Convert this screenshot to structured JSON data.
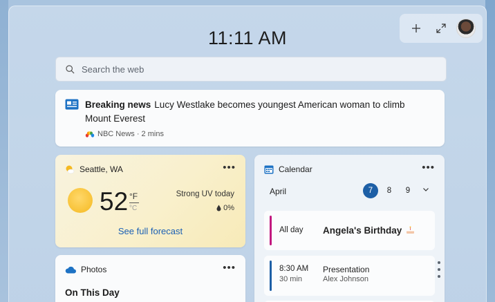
{
  "header": {
    "time": "11:11 AM"
  },
  "toolbar": {
    "add_icon": "plus-icon",
    "expand_icon": "expand-icon"
  },
  "search": {
    "placeholder": "Search the web"
  },
  "news": {
    "tag": "Breaking news",
    "headline": "Lucy Westlake becomes youngest American woman to climb Mount Everest",
    "source": "NBC News · 2 mins"
  },
  "weather": {
    "location": "Seattle, WA",
    "temperature": "52",
    "unit_f": "°F",
    "unit_c": "°C",
    "uv": "Strong UV today",
    "precip": "0%",
    "forecast_link": "See full forecast"
  },
  "photos": {
    "title": "Photos",
    "subtitle": "On This Day"
  },
  "calendar": {
    "title": "Calendar",
    "month": "April",
    "days": [
      "7",
      "8",
      "9"
    ],
    "selected_day": "7",
    "events": [
      {
        "time": "All day",
        "title": "Angela's Birthday",
        "accent": "#c2187f"
      },
      {
        "time": "8:30 AM",
        "duration": "30 min",
        "title": "Presentation",
        "organizer": "Alex Johnson",
        "accent": "#1d5fa6"
      }
    ]
  },
  "colors": {
    "accent": "#1d5fa6",
    "link": "#1a5fb4"
  }
}
